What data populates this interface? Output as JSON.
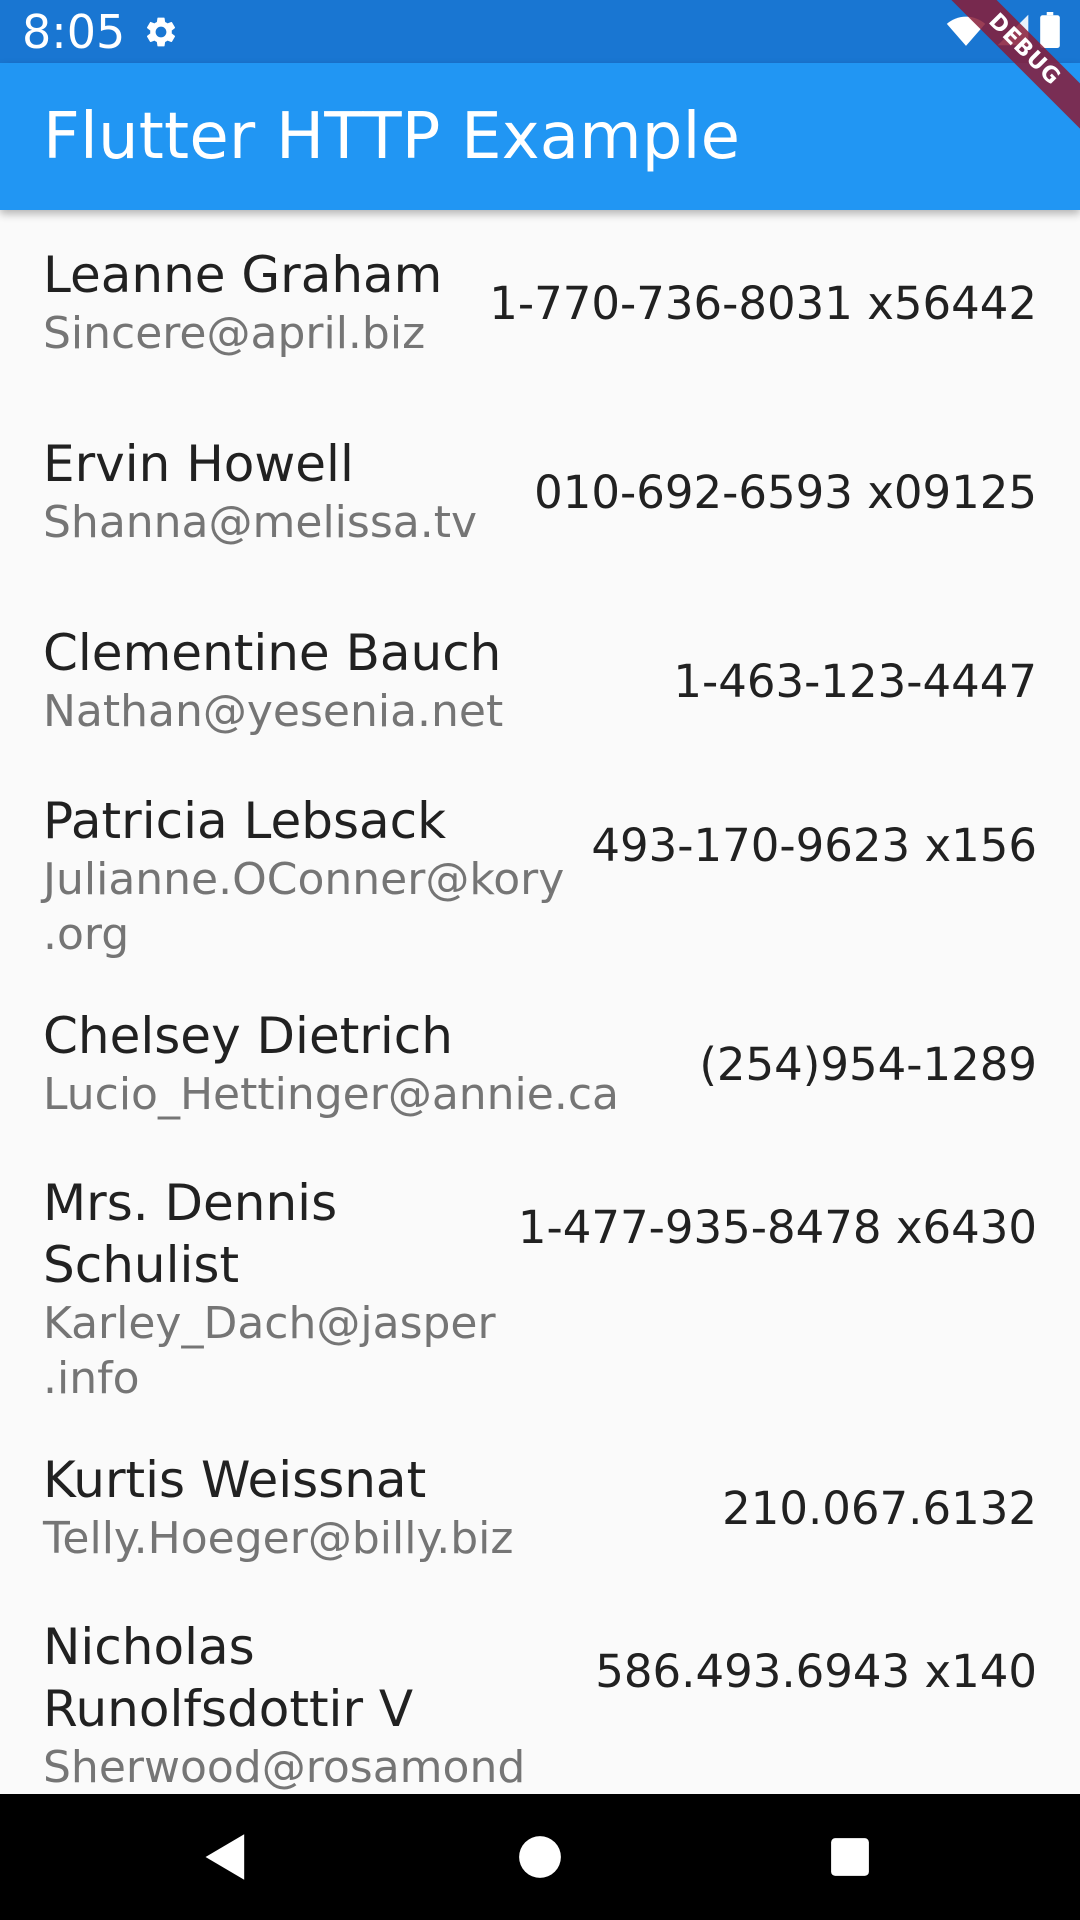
{
  "status_bar": {
    "time": "8:05",
    "icons": [
      "gear-icon",
      "wifi-icon",
      "signal-icon",
      "battery-icon"
    ]
  },
  "app_bar": {
    "title": "Flutter HTTP Example"
  },
  "debug_banner": {
    "label": "DEBUG"
  },
  "users": [
    {
      "name": "Leanne Graham",
      "email": "Sincere@april.biz",
      "phone": "1-770-736-8031 x56442"
    },
    {
      "name": "Ervin Howell",
      "email": "Shanna@melissa.tv",
      "phone": "010-692-6593 x09125"
    },
    {
      "name": "Clementine Bauch",
      "email": "Nathan@yesenia.net",
      "phone": "1-463-123-4447"
    },
    {
      "name": "Patricia Lebsack",
      "email_lines": [
        "Julianne.OConner@kory",
        ".org"
      ],
      "phone": "493-170-9623 x156"
    },
    {
      "name": "Chelsey Dietrich",
      "email": "Lucio_Hettinger@annie.ca",
      "phone": "(254)954-1289"
    },
    {
      "name_lines": [
        "Mrs. Dennis",
        "Schulist"
      ],
      "email_lines": [
        "Karley_Dach@jasper",
        ".info"
      ],
      "phone": "1-477-935-8478 x6430"
    },
    {
      "name": "Kurtis Weissnat",
      "email": "Telly.Hoeger@billy.biz",
      "phone": "210.067.6132"
    },
    {
      "name_lines": [
        "Nicholas",
        "Runolfsdottir V"
      ],
      "email": "Sherwood@rosamond",
      "phone": "586.493.6943 x140"
    }
  ],
  "nav_bar": {
    "buttons": [
      "back-icon",
      "home-icon",
      "recents-icon"
    ]
  },
  "colors": {
    "status_bar": "#1976d2",
    "app_bar": "#2196f3",
    "background": "#fafafa",
    "primary_text": "#212121",
    "secondary_text": "#757575",
    "debug_ribbon": "#881c37",
    "nav_bar": "#000000"
  }
}
